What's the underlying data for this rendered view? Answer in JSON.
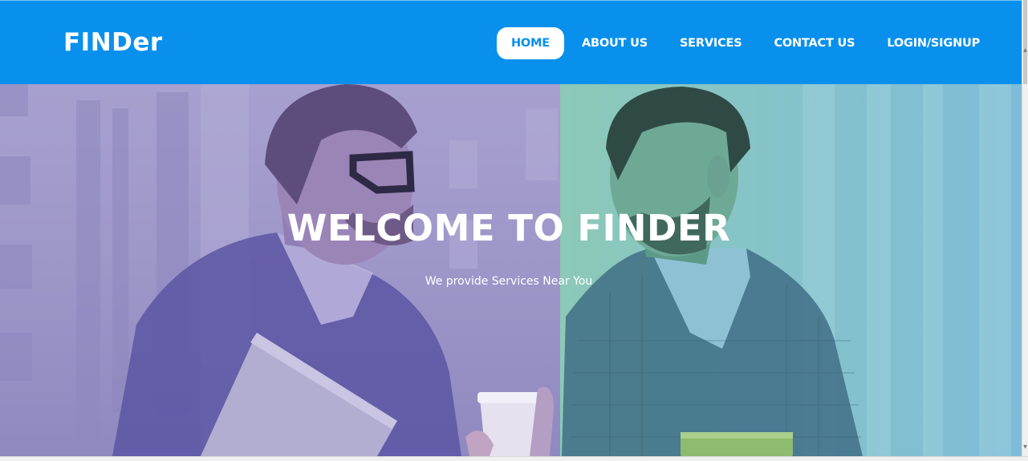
{
  "header": {
    "logo": "FINDer",
    "nav": [
      {
        "label": "HOME",
        "active": true
      },
      {
        "label": "ABOUT US",
        "active": false
      },
      {
        "label": "SERVICES",
        "active": false
      },
      {
        "label": "CONTACT US",
        "active": false
      },
      {
        "label": "LOGIN/SIGNUP",
        "active": false
      }
    ]
  },
  "hero": {
    "title": "WELCOME TO FINDER",
    "subtitle": "We provide Services Near You",
    "overlay_colors": {
      "left": "#a79fcd",
      "right": "#86c3c9"
    }
  },
  "colors": {
    "brand": "#0890ec",
    "text_on_brand": "#ffffff"
  }
}
